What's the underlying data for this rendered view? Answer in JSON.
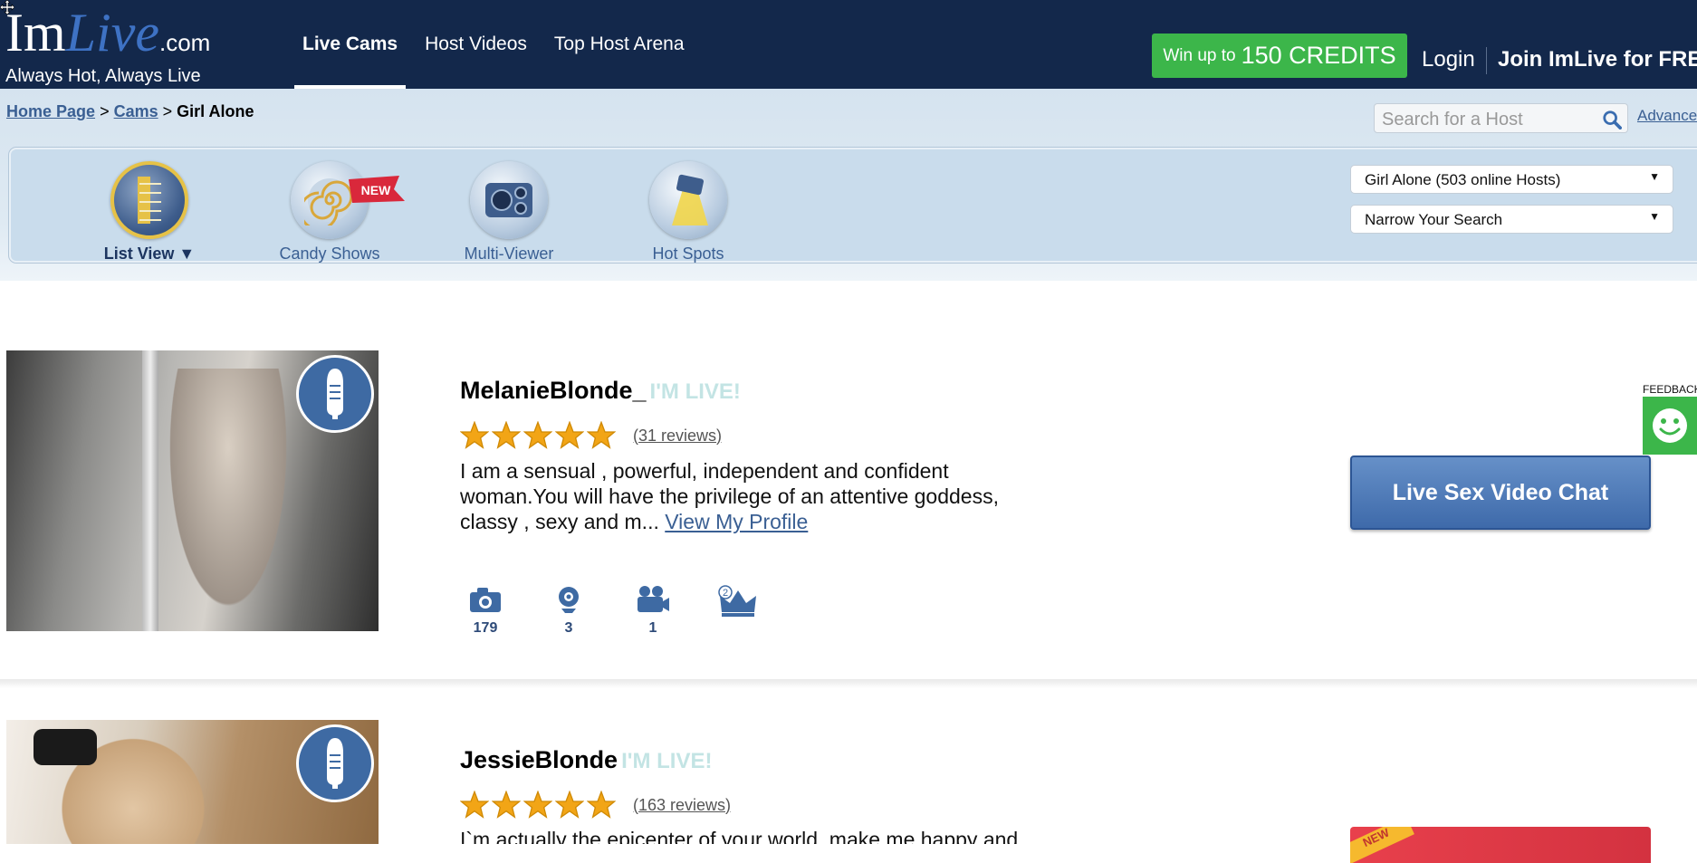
{
  "header": {
    "logo_im": "Im",
    "logo_live": "Live",
    "logo_com": ".com",
    "tagline": "Always Hot, Always Live",
    "nav": [
      {
        "label": "Live Cams",
        "active": true
      },
      {
        "label": "Host Videos",
        "active": false
      },
      {
        "label": "Top Host Arena",
        "active": false
      }
    ],
    "credits_prefix": "Win up to",
    "credits_amount": "150 CREDITS",
    "login": "Login",
    "join": "Join ImLive for FREE",
    "accent_green": "#3cb64a",
    "bg_color": "#13284b"
  },
  "breadcrumb": {
    "home": "Home Page",
    "sep": ">",
    "cams": "Cams",
    "current": "Girl Alone"
  },
  "search": {
    "placeholder": "Search for a Host",
    "advanced": "Advanced"
  },
  "views": [
    {
      "label": "List View ▼",
      "icon": "list-view-icon",
      "selected": true
    },
    {
      "label": "Candy Shows",
      "icon": "candy-spiral-icon",
      "selected": false,
      "badge": "NEW"
    },
    {
      "label": "Multi-Viewer",
      "icon": "multi-viewer-icon",
      "selected": false
    },
    {
      "label": "Hot Spots",
      "icon": "spotlight-icon",
      "selected": false
    }
  ],
  "filters": {
    "category": "Girl Alone  (503 online Hosts)",
    "narrow": "Narrow Your Search"
  },
  "feedback": "FEEDBACK",
  "listings": [
    {
      "name": "MelanieBlonde_",
      "live_tag": "I'M LIVE!",
      "rating": 5,
      "reviews": "(31 reviews)",
      "description": "I am a sensual , powerful, independent and confident woman.You will have the privilege of an attentive goddess, classy , sexy and m...",
      "profile_link": "View My Profile",
      "stats": {
        "photos": "179",
        "webcam": "3",
        "videos": "1",
        "crown": ""
      },
      "crown_badge": "2",
      "cta": "Live Sex Video Chat"
    },
    {
      "name": "JessieBlonde",
      "live_tag": "I'M LIVE!",
      "rating": 5,
      "reviews": "(163 reviews)",
      "description": "I`m actually the epicenter of your world, make me happy and",
      "cta_badge": "NEW"
    }
  ]
}
